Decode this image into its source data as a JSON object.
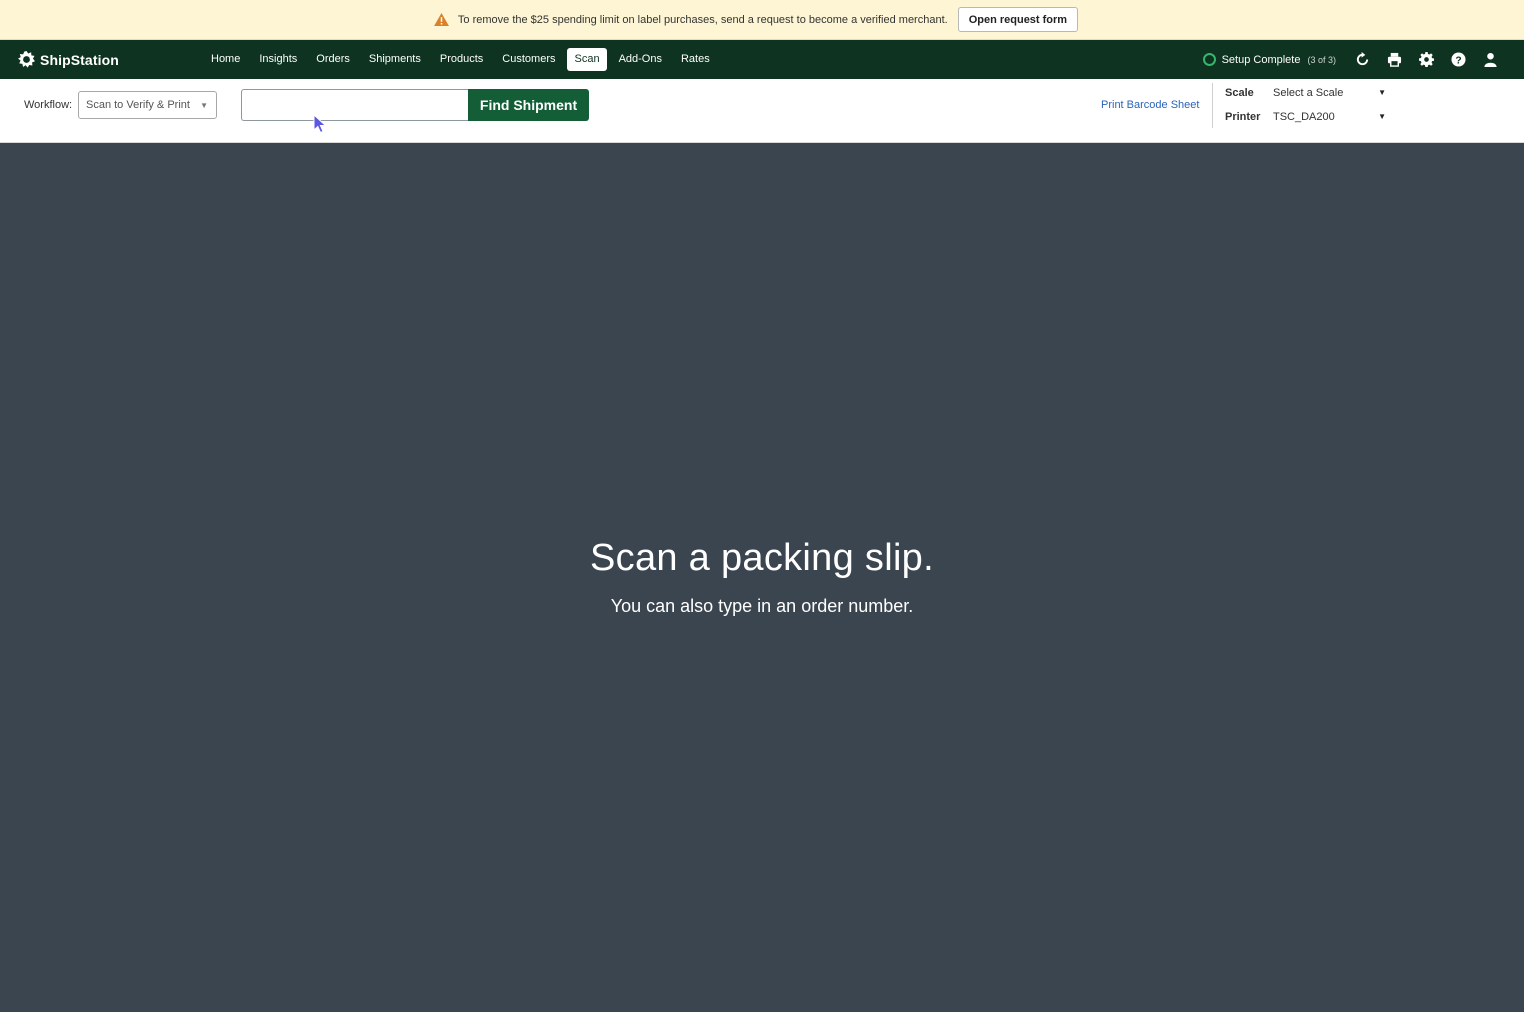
{
  "banner": {
    "icon": "warning-icon",
    "text": "To remove the $25 spending limit on label purchases, send a request to become a verified merchant.",
    "button_label": "Open request form"
  },
  "nav": {
    "brand": "ShipStation",
    "items": [
      {
        "label": "Home"
      },
      {
        "label": "Insights"
      },
      {
        "label": "Orders"
      },
      {
        "label": "Shipments"
      },
      {
        "label": "Products"
      },
      {
        "label": "Customers"
      },
      {
        "label": "Scan",
        "active": true
      },
      {
        "label": "Add-Ons"
      },
      {
        "label": "Rates"
      }
    ],
    "setup_label": "Setup Complete",
    "setup_count": "(3 of 3)",
    "icons": [
      "refresh-icon",
      "printer-icon",
      "gear-icon",
      "help-icon",
      "user-icon"
    ]
  },
  "toolbar": {
    "workflow_label": "Workflow:",
    "workflow_value": "Scan to Verify & Print",
    "search_value": "",
    "find_button": "Find Shipment",
    "barcode_link": "Print Barcode Sheet",
    "scale_label": "Scale",
    "scale_value": "Select a Scale",
    "printer_label": "Printer",
    "printer_value": "TSC_DA200"
  },
  "main": {
    "headline": "Scan a packing slip.",
    "subline": "You can also type in an order number."
  },
  "colors": {
    "banner_bg": "#fdf5d3",
    "nav_bg": "#0e3321",
    "accent": "#135e36",
    "link": "#2a64b8",
    "main_bg": "#3b4550",
    "setup_ring": "#35b66b"
  }
}
